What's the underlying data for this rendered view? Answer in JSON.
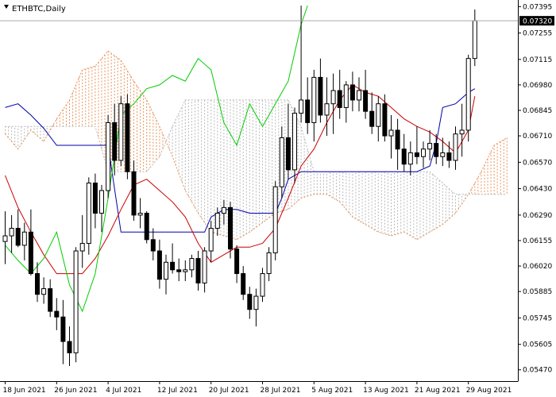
{
  "header": {
    "symbol_title": "ETHBTC,Daily",
    "dropdown_icon": "triangle-down-icon"
  },
  "colors": {
    "tenkan": "#cc0000",
    "kijun": "#0000aa",
    "chikou": "#00cc00",
    "span_a": "#e8935b",
    "span_b": "#b8b8b8",
    "candle_outline": "#000000",
    "bull_fill": "#ffffff",
    "bear_fill": "#000000",
    "price_label_bg": "#000000",
    "price_label_text": "#ffffff"
  },
  "chart_data": {
    "type": "candlestick",
    "title": "ETHBTC,Daily",
    "current_price": "0.07320",
    "y_ticks": [
      "0.07395",
      "0.07255",
      "0.07115",
      "0.06980",
      "0.06845",
      "0.06710",
      "0.06570",
      "0.06430",
      "0.06290",
      "0.06155",
      "0.06020",
      "0.05885",
      "0.05745",
      "0.05605",
      "0.05470"
    ],
    "ylim": [
      0.0541,
      0.0743
    ],
    "x_ticks": [
      {
        "label": "18 Jun 2021",
        "bar": 0
      },
      {
        "label": "26 Jun 2021",
        "bar": 8
      },
      {
        "label": "4 Jul 2021",
        "bar": 16
      },
      {
        "label": "12 Jul 2021",
        "bar": 24
      },
      {
        "label": "20 Jul 2021",
        "bar": 32
      },
      {
        "label": "28 Jul 2021",
        "bar": 40
      },
      {
        "label": "5 Aug 2021",
        "bar": 48
      },
      {
        "label": "13 Aug 2021",
        "bar": 56
      },
      {
        "label": "21 Aug 2021",
        "bar": 64
      },
      {
        "label": "29 Aug 2021",
        "bar": 72
      }
    ],
    "candles": [
      [
        0.0615,
        0.0631,
        0.0603,
        0.0618
      ],
      [
        0.0618,
        0.0629,
        0.0609,
        0.0622
      ],
      [
        0.0622,
        0.0632,
        0.0612,
        0.0613
      ],
      [
        0.0613,
        0.0625,
        0.0605,
        0.062
      ],
      [
        0.062,
        0.0632,
        0.0597,
        0.0598
      ],
      [
        0.0598,
        0.0604,
        0.0583,
        0.0587
      ],
      [
        0.0587,
        0.0596,
        0.0582,
        0.059
      ],
      [
        0.059,
        0.0595,
        0.0575,
        0.0578
      ],
      [
        0.0578,
        0.0585,
        0.0568,
        0.0575
      ],
      [
        0.0575,
        0.0584,
        0.055,
        0.0562
      ],
      [
        0.0562,
        0.057,
        0.0549,
        0.0556
      ],
      [
        0.0556,
        0.0612,
        0.0551,
        0.061
      ],
      [
        0.061,
        0.0629,
        0.0601,
        0.0614
      ],
      [
        0.0614,
        0.0649,
        0.0608,
        0.0646
      ],
      [
        0.0646,
        0.0651,
        0.0622,
        0.063
      ],
      [
        0.063,
        0.0645,
        0.062,
        0.0642
      ],
      [
        0.0642,
        0.0682,
        0.0638,
        0.0678
      ],
      [
        0.0678,
        0.0688,
        0.065,
        0.0658
      ],
      [
        0.0658,
        0.0692,
        0.0655,
        0.0688
      ],
      [
        0.0688,
        0.0693,
        0.0648,
        0.0652
      ],
      [
        0.0652,
        0.0658,
        0.0626,
        0.0629
      ],
      [
        0.0629,
        0.0638,
        0.0622,
        0.063
      ],
      [
        0.063,
        0.0631,
        0.0614,
        0.0616
      ],
      [
        0.0616,
        0.0622,
        0.0605,
        0.061
      ],
      [
        0.061,
        0.0616,
        0.059,
        0.0595
      ],
      [
        0.0595,
        0.0608,
        0.0587,
        0.0604
      ],
      [
        0.0604,
        0.0614,
        0.0598,
        0.06
      ],
      [
        0.06,
        0.0606,
        0.0594,
        0.0599
      ],
      [
        0.0599,
        0.0605,
        0.0594,
        0.06
      ],
      [
        0.06,
        0.0608,
        0.0596,
        0.0606
      ],
      [
        0.0606,
        0.061,
        0.0589,
        0.0593
      ],
      [
        0.0593,
        0.0612,
        0.0588,
        0.061
      ],
      [
        0.061,
        0.0626,
        0.0604,
        0.0622
      ],
      [
        0.0622,
        0.0633,
        0.0618,
        0.063
      ],
      [
        0.063,
        0.0637,
        0.0624,
        0.0633
      ],
      [
        0.0633,
        0.0636,
        0.0606,
        0.0611
      ],
      [
        0.0611,
        0.0613,
        0.0593,
        0.0598
      ],
      [
        0.0598,
        0.0602,
        0.0584,
        0.0587
      ],
      [
        0.0587,
        0.0591,
        0.0574,
        0.0579
      ],
      [
        0.0579,
        0.059,
        0.057,
        0.0586
      ],
      [
        0.0586,
        0.0601,
        0.0583,
        0.0598
      ],
      [
        0.0598,
        0.0612,
        0.0594,
        0.0609
      ],
      [
        0.0609,
        0.0647,
        0.0605,
        0.0644
      ],
      [
        0.0644,
        0.0676,
        0.0638,
        0.067
      ],
      [
        0.067,
        0.0688,
        0.0648,
        0.0653
      ],
      [
        0.0653,
        0.0686,
        0.0646,
        0.0683
      ],
      [
        0.0683,
        0.074,
        0.0678,
        0.069
      ],
      [
        0.069,
        0.0702,
        0.0672,
        0.0678
      ],
      [
        0.0678,
        0.0706,
        0.0668,
        0.0702
      ],
      [
        0.0702,
        0.0712,
        0.0678,
        0.0682
      ],
      [
        0.0682,
        0.0702,
        0.0671,
        0.0688
      ],
      [
        0.0688,
        0.0704,
        0.0672,
        0.0695
      ],
      [
        0.0695,
        0.0706,
        0.068,
        0.0686
      ],
      [
        0.0686,
        0.07,
        0.0678,
        0.0698
      ],
      [
        0.0698,
        0.0705,
        0.0684,
        0.069
      ],
      [
        0.069,
        0.0702,
        0.0684,
        0.0695
      ],
      [
        0.0695,
        0.0706,
        0.068,
        0.0684
      ],
      [
        0.0684,
        0.0694,
        0.0672,
        0.0676
      ],
      [
        0.0676,
        0.0692,
        0.0668,
        0.0688
      ],
      [
        0.0688,
        0.0693,
        0.0668,
        0.0671
      ],
      [
        0.0671,
        0.0682,
        0.0659,
        0.0674
      ],
      [
        0.0674,
        0.068,
        0.0653,
        0.0664
      ],
      [
        0.0664,
        0.0672,
        0.0652,
        0.0656
      ],
      [
        0.0656,
        0.0668,
        0.065,
        0.0662
      ],
      [
        0.0662,
        0.0676,
        0.0656,
        0.066
      ],
      [
        0.066,
        0.0668,
        0.0654,
        0.0664
      ],
      [
        0.0664,
        0.0674,
        0.0658,
        0.0667
      ],
      [
        0.0667,
        0.0672,
        0.0656,
        0.066
      ],
      [
        0.066,
        0.067,
        0.0655,
        0.0662
      ],
      [
        0.0662,
        0.0668,
        0.0654,
        0.0658
      ],
      [
        0.0658,
        0.0676,
        0.0653,
        0.0672
      ],
      [
        0.0672,
        0.0688,
        0.066,
        0.0674
      ],
      [
        0.0674,
        0.0714,
        0.0668,
        0.0712
      ],
      [
        0.0712,
        0.0738,
        0.0708,
        0.0732
      ]
    ],
    "tenkan": [
      [
        0,
        0.065
      ],
      [
        2,
        0.0633
      ],
      [
        4,
        0.062
      ],
      [
        6,
        0.0608
      ],
      [
        8,
        0.0598
      ],
      [
        10,
        0.0598
      ],
      [
        12,
        0.0598
      ],
      [
        14,
        0.0606
      ],
      [
        16,
        0.0618
      ],
      [
        18,
        0.0632
      ],
      [
        20,
        0.0645
      ],
      [
        22,
        0.0648
      ],
      [
        24,
        0.0642
      ],
      [
        26,
        0.0636
      ],
      [
        28,
        0.0628
      ],
      [
        30,
        0.0614
      ],
      [
        32,
        0.0604
      ],
      [
        34,
        0.0608
      ],
      [
        36,
        0.0612
      ],
      [
        38,
        0.0612
      ],
      [
        40,
        0.0614
      ],
      [
        42,
        0.0622
      ],
      [
        44,
        0.0638
      ],
      [
        46,
        0.0655
      ],
      [
        48,
        0.0664
      ],
      [
        50,
        0.0678
      ],
      [
        52,
        0.069
      ],
      [
        54,
        0.0698
      ],
      [
        56,
        0.0694
      ],
      [
        58,
        0.0692
      ],
      [
        60,
        0.0686
      ],
      [
        62,
        0.068
      ],
      [
        64,
        0.0676
      ],
      [
        66,
        0.0673
      ],
      [
        68,
        0.0668
      ],
      [
        70,
        0.0662
      ],
      [
        72,
        0.0674
      ],
      [
        73,
        0.0692
      ]
    ],
    "kijun": [
      [
        0,
        0.0686
      ],
      [
        2,
        0.0688
      ],
      [
        4,
        0.0682
      ],
      [
        6,
        0.0675
      ],
      [
        8,
        0.0666
      ],
      [
        10,
        0.0666
      ],
      [
        12,
        0.0666
      ],
      [
        14,
        0.0666
      ],
      [
        16,
        0.0666
      ],
      [
        18,
        0.062
      ],
      [
        20,
        0.062
      ],
      [
        22,
        0.062
      ],
      [
        24,
        0.062
      ],
      [
        26,
        0.062
      ],
      [
        28,
        0.062
      ],
      [
        30,
        0.062
      ],
      [
        31,
        0.062
      ],
      [
        32,
        0.0628
      ],
      [
        34,
        0.0632
      ],
      [
        36,
        0.0632
      ],
      [
        38,
        0.063
      ],
      [
        40,
        0.063
      ],
      [
        42,
        0.063
      ],
      [
        43,
        0.0638
      ],
      [
        44,
        0.0648
      ],
      [
        46,
        0.0652
      ],
      [
        48,
        0.0652
      ],
      [
        50,
        0.0652
      ],
      [
        52,
        0.0652
      ],
      [
        54,
        0.0652
      ],
      [
        56,
        0.0652
      ],
      [
        58,
        0.0652
      ],
      [
        60,
        0.0652
      ],
      [
        62,
        0.0652
      ],
      [
        64,
        0.0652
      ],
      [
        66,
        0.0655
      ],
      [
        67,
        0.0667
      ],
      [
        68,
        0.0686
      ],
      [
        70,
        0.0688
      ],
      [
        72,
        0.0694
      ],
      [
        73,
        0.0696
      ]
    ],
    "chikou": [
      [
        0,
        0.0613
      ],
      [
        2,
        0.0605
      ],
      [
        4,
        0.0598
      ],
      [
        6,
        0.0606
      ],
      [
        8,
        0.062
      ],
      [
        10,
        0.0592
      ],
      [
        12,
        0.0578
      ],
      [
        14,
        0.0598
      ],
      [
        16,
        0.0638
      ],
      [
        18,
        0.0682
      ],
      [
        20,
        0.0688
      ],
      [
        22,
        0.0696
      ],
      [
        24,
        0.0698
      ],
      [
        26,
        0.0703
      ],
      [
        28,
        0.07
      ],
      [
        30,
        0.0712
      ],
      [
        32,
        0.0706
      ],
      [
        34,
        0.0678
      ],
      [
        36,
        0.0666
      ],
      [
        38,
        0.0688
      ],
      [
        40,
        0.0676
      ],
      [
        42,
        0.0688
      ],
      [
        44,
        0.07
      ],
      [
        46,
        0.073
      ],
      [
        47,
        0.074
      ]
    ],
    "span_a": [
      [
        0,
        0.0672
      ],
      [
        2,
        0.0664
      ],
      [
        4,
        0.0674
      ],
      [
        6,
        0.0668
      ],
      [
        8,
        0.068
      ],
      [
        10,
        0.069
      ],
      [
        12,
        0.0706
      ],
      [
        14,
        0.0708
      ],
      [
        16,
        0.0716
      ],
      [
        18,
        0.0711
      ],
      [
        20,
        0.07
      ],
      [
        22,
        0.069
      ],
      [
        24,
        0.0676
      ],
      [
        26,
        0.066
      ],
      [
        28,
        0.0642
      ],
      [
        30,
        0.063
      ],
      [
        32,
        0.062
      ],
      [
        34,
        0.0618
      ],
      [
        36,
        0.0616
      ],
      [
        38,
        0.062
      ],
      [
        40,
        0.0625
      ],
      [
        42,
        0.063
      ],
      [
        44,
        0.0632
      ],
      [
        46,
        0.0638
      ],
      [
        48,
        0.064
      ],
      [
        50,
        0.064
      ],
      [
        52,
        0.0636
      ],
      [
        54,
        0.0628
      ],
      [
        56,
        0.0624
      ],
      [
        58,
        0.062
      ],
      [
        60,
        0.0618
      ],
      [
        62,
        0.062
      ],
      [
        64,
        0.0616
      ],
      [
        66,
        0.062
      ],
      [
        68,
        0.0624
      ],
      [
        70,
        0.063
      ],
      [
        72,
        0.064
      ],
      [
        74,
        0.0652
      ],
      [
        76,
        0.0666
      ],
      [
        78,
        0.067
      ]
    ],
    "span_b": [
      [
        0,
        0.0676
      ],
      [
        2,
        0.0676
      ],
      [
        4,
        0.0676
      ],
      [
        6,
        0.0676
      ],
      [
        8,
        0.0676
      ],
      [
        10,
        0.0676
      ],
      [
        12,
        0.0676
      ],
      [
        14,
        0.0676
      ],
      [
        16,
        0.0652
      ],
      [
        18,
        0.0652
      ],
      [
        20,
        0.0652
      ],
      [
        22,
        0.0652
      ],
      [
        24,
        0.066
      ],
      [
        26,
        0.0676
      ],
      [
        28,
        0.069
      ],
      [
        30,
        0.069
      ],
      [
        32,
        0.069
      ],
      [
        34,
        0.069
      ],
      [
        36,
        0.069
      ],
      [
        38,
        0.069
      ],
      [
        40,
        0.069
      ],
      [
        42,
        0.069
      ],
      [
        44,
        0.069
      ],
      [
        46,
        0.0676
      ],
      [
        48,
        0.0652
      ],
      [
        50,
        0.0652
      ],
      [
        52,
        0.0652
      ],
      [
        54,
        0.0652
      ],
      [
        56,
        0.0652
      ],
      [
        58,
        0.0652
      ],
      [
        60,
        0.0652
      ],
      [
        62,
        0.0652
      ],
      [
        64,
        0.0652
      ],
      [
        66,
        0.0652
      ],
      [
        68,
        0.0646
      ],
      [
        70,
        0.064
      ],
      [
        72,
        0.064
      ],
      [
        74,
        0.064
      ],
      [
        76,
        0.064
      ],
      [
        78,
        0.064
      ]
    ]
  }
}
